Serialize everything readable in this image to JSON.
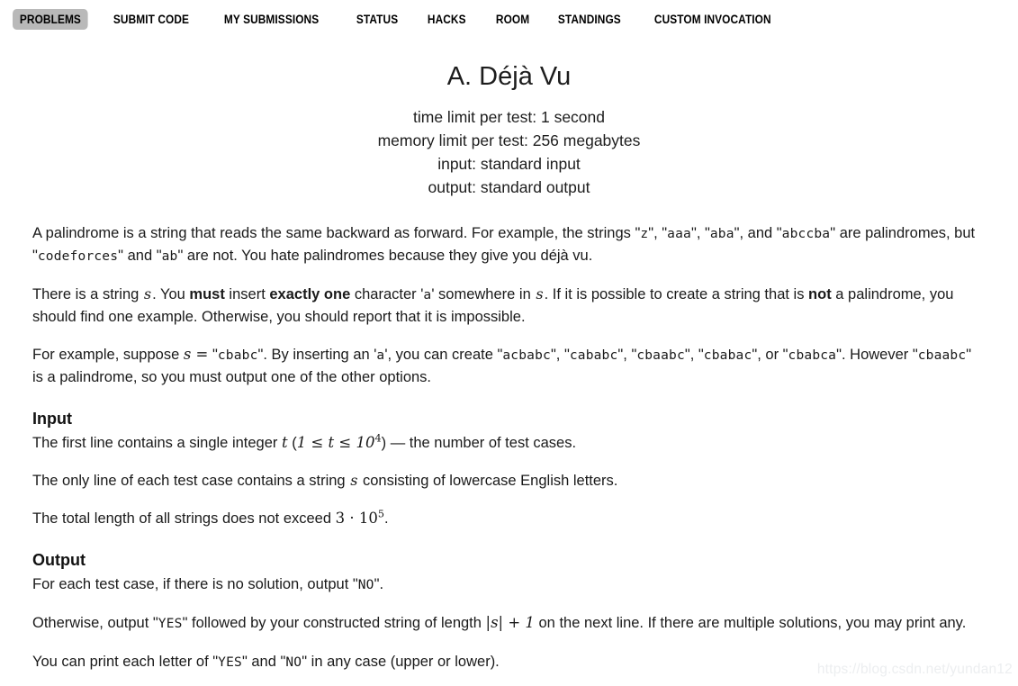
{
  "nav": {
    "items": [
      {
        "label": "PROBLEMS",
        "active": true,
        "name": "nav-problems"
      },
      {
        "label": "SUBMIT CODE",
        "active": false,
        "name": "nav-submit-code"
      },
      {
        "label": "MY SUBMISSIONS",
        "active": false,
        "name": "nav-my-submissions"
      },
      {
        "label": "STATUS",
        "active": false,
        "name": "nav-status"
      },
      {
        "label": "HACKS",
        "active": false,
        "name": "nav-hacks"
      },
      {
        "label": "ROOM",
        "active": false,
        "name": "nav-room"
      },
      {
        "label": "STANDINGS",
        "active": false,
        "name": "nav-standings"
      },
      {
        "label": "CUSTOM INVOCATION",
        "active": false,
        "name": "nav-custom-invocation"
      }
    ],
    "active_background": "#b9b9b9"
  },
  "problem": {
    "title": "A. Déjà Vu",
    "time_limit": "time limit per test: 1 second",
    "memory_limit": "memory limit per test: 256 megabytes",
    "input_source": "input: standard input",
    "output_source": "output: standard output"
  },
  "statement": {
    "p1": {
      "t1": "A palindrome is a string that reads the same backward as forward. For example, the strings \"",
      "s1": "z",
      "t2": "\", \"",
      "s2": "aaa",
      "t3": "\", \"",
      "s3": "aba",
      "t4": "\", and \"",
      "s4": "abccba",
      "t5": "\" are palindromes, but \"",
      "s5": "codeforces",
      "t6": "\" and \"",
      "s6": "ab",
      "t7": "\" are not. You hate palindromes because they give you déjà vu."
    },
    "p2": {
      "t1": "There is a string ",
      "v1": "s",
      "t2": ". You ",
      "b1": "must",
      "t3": " insert ",
      "b2": "exactly one",
      "t4": " character '",
      "s1": "a",
      "t5": "' somewhere in ",
      "v2": "s",
      "t6": ". If it is possible to create a string that is ",
      "b3": "not",
      "t7": " a palindrome, you should find one example. Otherwise, you should report that it is impossible."
    },
    "p3": {
      "t1": "For example, suppose ",
      "m1": "s =",
      "t2": " \"",
      "s1": "cbabc",
      "t3": "\". By inserting an '",
      "s2": "a",
      "t4": "', you can create \"",
      "s3": "acbabc",
      "t5": "\", \"",
      "s4": "cababc",
      "t6": "\", \"",
      "s5": "cbaabc",
      "t7": "\", \"",
      "s6": "cbabac",
      "t8": "\", or \"",
      "s7": "cbabca",
      "t9": "\". However \"",
      "s8": "cbaabc",
      "t10": "\" is a palindrome, so you must output one of the other options."
    },
    "input_heading": "Input",
    "p4": {
      "t1": "The first line contains a single integer ",
      "m1": "t",
      "t2": " (",
      "m2": "1 ≤ t ≤ 10",
      "m2sup": "4",
      "t3": ") — the number of test cases."
    },
    "p5": {
      "t1": "The only line of each test case contains a string ",
      "v1": "s",
      "t2": " consisting of lowercase English letters."
    },
    "p6": {
      "t1": "The total length of all strings does not exceed ",
      "m1": "3 · 10",
      "m1sup": "5",
      "t2": "."
    },
    "output_heading": "Output",
    "p7": {
      "t1": "For each test case, if there is no solution, output \"",
      "s1": "NO",
      "t2": "\"."
    },
    "p8": {
      "t1": "Otherwise, output \"",
      "s1": "YES",
      "t2": "\" followed by your constructed string of length ",
      "m1": "|s| + 1",
      "t3": " on the next line. If there are multiple solutions, you may print any."
    },
    "p9": {
      "t1": "You can print each letter of \"",
      "s1": "YES",
      "t2": "\" and \"",
      "s2": "NO",
      "t3": "\" in any case (upper or lower)."
    }
  },
  "watermark": "https://blog.csdn.net/yundan12"
}
